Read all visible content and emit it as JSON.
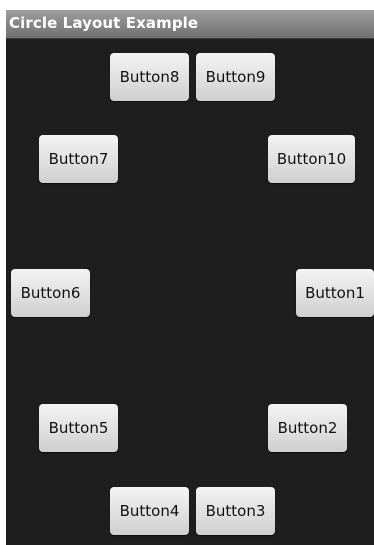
{
  "app": {
    "title": "Circle Layout Example"
  },
  "buttons": {
    "b1": "Button1",
    "b2": "Button2",
    "b3": "Button3",
    "b4": "Button4",
    "b5": "Button5",
    "b6": "Button6",
    "b7": "Button7",
    "b8": "Button8",
    "b9": "Button9",
    "b10": "Button10"
  },
  "colors": {
    "background": "#1e1e1e",
    "title_bar": "#808080",
    "button_face": "#e6e6e6"
  }
}
